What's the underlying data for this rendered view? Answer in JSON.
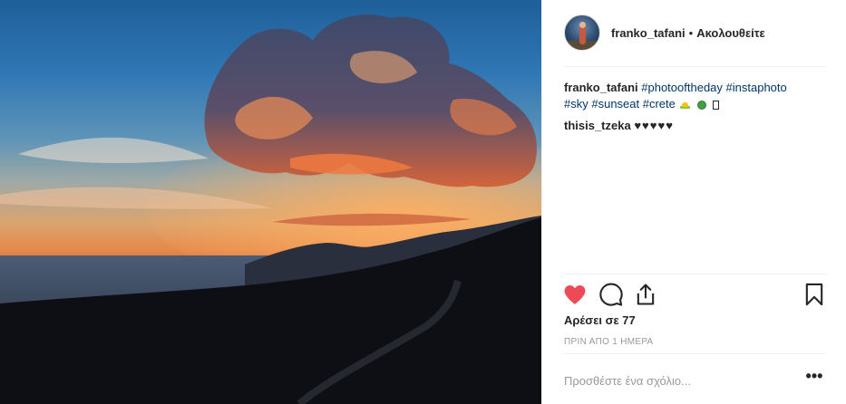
{
  "post": {
    "image_alt": "",
    "author": {
      "username": "franko_tafani",
      "separator": "•",
      "follow_status": "Ακολουθείτε"
    },
    "caption": {
      "username": "franko_tafani",
      "tags_line1": [
        "#photooftheday",
        "#instaphoto"
      ],
      "tags_line2": [
        "#sky",
        "#sunseat",
        "#crete"
      ]
    },
    "comments": [
      {
        "username": "thisis_tzeka",
        "text": "♥♥♥♥♥"
      }
    ],
    "actions": {
      "like_icon": "heart-filled-icon",
      "comment_icon": "speech-bubble-icon",
      "share_icon": "share-upload-icon",
      "save_icon": "bookmark-icon",
      "liked": true,
      "like_color": "#ed4956"
    },
    "likes_text": "Αρέσει σε 77",
    "timestamp": "ΠΡΙΝ ΑΠΟ 1 ΗΜΕΡΑ",
    "add_comment_placeholder": "Προσθέστε ένα σχόλιο...",
    "more_options": "•••"
  }
}
